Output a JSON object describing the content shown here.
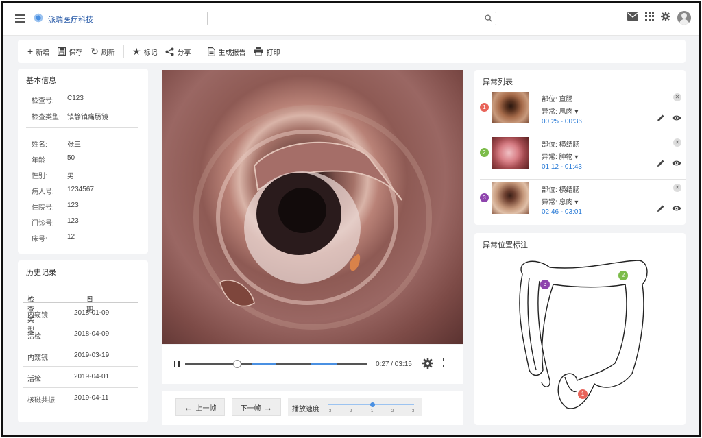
{
  "header": {
    "brand": "派瑞医疗科技",
    "search": {
      "value": "",
      "placeholder": ""
    }
  },
  "toolbar": {
    "items": [
      {
        "icon": "plus-icon",
        "label": "新增"
      },
      {
        "icon": "save-icon",
        "label": "保存"
      },
      {
        "icon": "refresh-icon",
        "label": "刷新"
      },
      {
        "icon": "star-icon",
        "label": "标记"
      },
      {
        "icon": "share-icon",
        "label": "分享"
      },
      {
        "icon": "report-icon",
        "label": "生成报告"
      },
      {
        "icon": "print-icon",
        "label": "打印"
      }
    ]
  },
  "basic_info": {
    "title": "基本信息",
    "exam": [
      {
        "key": "检查号:",
        "value": "C123"
      },
      {
        "key": "检查类型:",
        "value": "镇静镇痛肠镜"
      }
    ],
    "patient": [
      {
        "key": "姓名:",
        "value": "张三"
      },
      {
        "key": "年龄",
        "value": "50"
      },
      {
        "key": "性别:",
        "value": "男"
      },
      {
        "key": "病人号:",
        "value": "1234567"
      },
      {
        "key": "住院号:",
        "value": "123"
      },
      {
        "key": "门诊号:",
        "value": "123"
      },
      {
        "key": "床号:",
        "value": "12"
      }
    ]
  },
  "history": {
    "title": "历史记录",
    "columns": [
      "检查类型",
      "日期"
    ],
    "rows": [
      {
        "type": "内窥镜",
        "date": "2018-01-09"
      },
      {
        "type": "活检",
        "date": "2018-04-09"
      },
      {
        "type": "内窥镜",
        "date": "2019-03-19"
      },
      {
        "type": "活检",
        "date": "2019-04-01"
      },
      {
        "type": "核磁共振",
        "date": "2019-04-11"
      }
    ]
  },
  "player": {
    "time": "0:27 / 03:15",
    "progress": 0.138
  },
  "frame_nav": {
    "prev": "上一帧",
    "next": "下一帧",
    "speed_label": "播放速度",
    "speed_ticks": [
      "-3",
      "-2",
      "1",
      "2",
      "3"
    ],
    "speed_value": "1"
  },
  "anomalies": {
    "title": "异常列表",
    "items": [
      {
        "num": "1",
        "color": "#e8645a",
        "location": "部位: 直肠",
        "type": "异常: 息肉",
        "range": "00:25 - 00:36"
      },
      {
        "num": "2",
        "color": "#7cbc4a",
        "location": "部位: 横结肠",
        "type": "异常: 肿物",
        "range": "01:12 - 01:43"
      },
      {
        "num": "3",
        "color": "#8e44ad",
        "location": "部位: 横结肠",
        "type": "异常: 息肉",
        "range": "02:46 - 03:01"
      }
    ]
  },
  "location_map": {
    "title": "异常位置标注",
    "pins": [
      "1",
      "2",
      "3"
    ]
  }
}
